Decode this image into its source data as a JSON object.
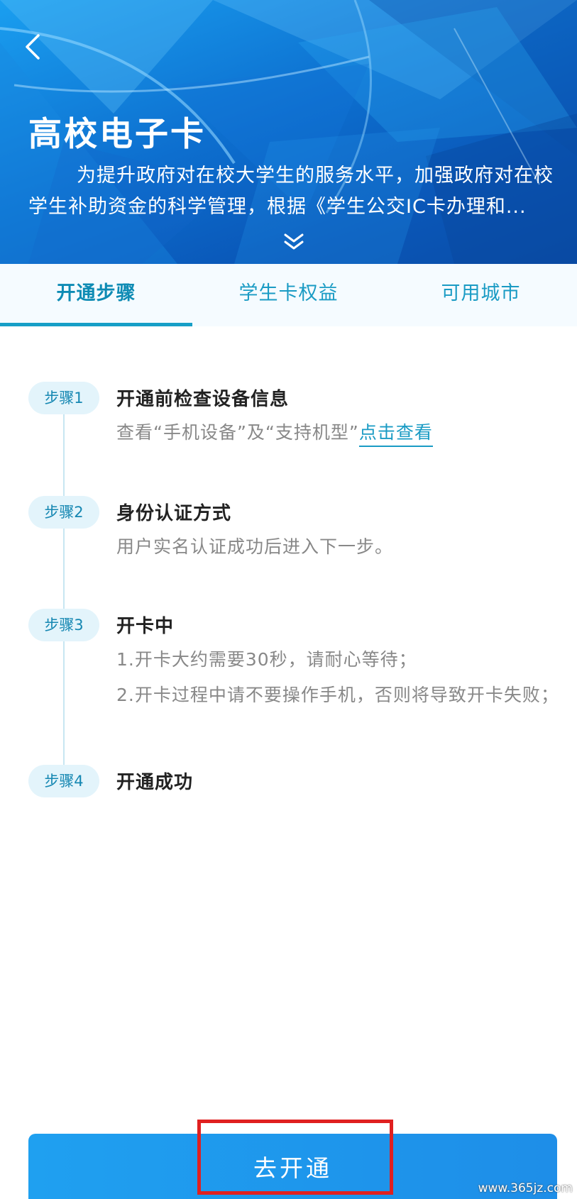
{
  "header": {
    "title": "高校电子卡",
    "description": "为提升政府对在校大学生的服务水平，加强政府对在校学生补助资金的科学管理，根据《学生公交IC卡办理和...",
    "back_icon": "chevron-left-icon",
    "expand_icon": "double-chevron-down-icon"
  },
  "tabs": [
    {
      "label": "开通步骤",
      "active": true
    },
    {
      "label": "学生卡权益",
      "active": false
    },
    {
      "label": "可用城市",
      "active": false
    }
  ],
  "steps": [
    {
      "badge": "步骤1",
      "title": "开通前检查设备信息",
      "desc_prefix": "查看“手机设备”及“支持机型”",
      "link": "点击查看"
    },
    {
      "badge": "步骤2",
      "title": "身份认证方式",
      "desc": "用户实名认证成功后进入下一步。"
    },
    {
      "badge": "步骤3",
      "title": "开卡中",
      "desc_lines": [
        "1.开卡大约需要30秒，请耐心等待；",
        "2.开卡过程中请不要操作手机，否则将导致开卡失败；"
      ]
    },
    {
      "badge": "步骤4",
      "title": "开通成功"
    }
  ],
  "action": {
    "button_label": "去开通"
  },
  "watermark": "www.365jz.com",
  "colors": {
    "accent": "#1a9bc4",
    "button": "#1e96ec",
    "highlight": "#e02020"
  }
}
